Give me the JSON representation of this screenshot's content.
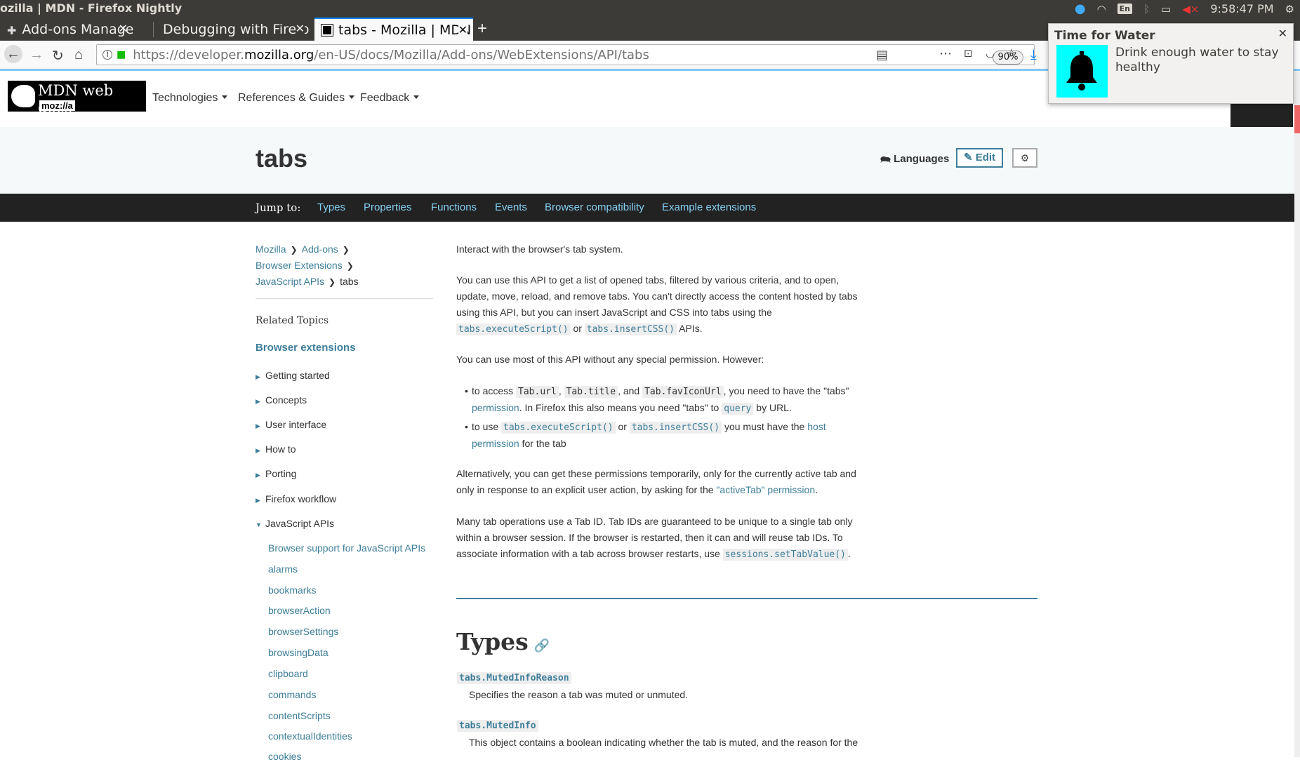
{
  "os": {
    "window_title": "ozilla | MDN - Firefox Nightly",
    "keyboard": "En",
    "clock": "9:58:47 PM"
  },
  "tabs": [
    {
      "label": "Add-ons Manager"
    },
    {
      "label": "Debugging with Firefo"
    },
    {
      "label": "tabs - Mozilla | MDN"
    }
  ],
  "navbar": {
    "url_prefix": "https://developer.",
    "url_domain": "mozilla.org",
    "url_path": "/en-US/docs/Mozilla/Add-ons/WebExtensions/API/tabs",
    "zoom": "90%"
  },
  "notification": {
    "title": "Time for Water",
    "body": "Drink enough water to stay healthy"
  },
  "mdn": {
    "logo_main": "MDN web docs",
    "logo_sub": "moz://a",
    "nav": [
      "Technologies",
      "References & Guides",
      "Feedback"
    ]
  },
  "page": {
    "title": "tabs",
    "languages": "Languages",
    "edit": "Edit"
  },
  "jump": {
    "label": "Jump to:",
    "links": [
      "Types",
      "Properties",
      "Functions",
      "Events",
      "Browser compatibility",
      "Example extensions"
    ]
  },
  "sidebar": {
    "breadcrumbs": [
      "Mozilla",
      "Add-ons",
      "Browser Extensions",
      "JavaScript APIs",
      "tabs"
    ],
    "related": "Related Topics",
    "section": "Browser extensions",
    "items": [
      "Getting started",
      "Concepts",
      "User interface",
      "How to",
      "Porting",
      "Firefox workflow",
      "JavaScript APIs"
    ],
    "subitems": [
      "Browser support for JavaScript APIs",
      "alarms",
      "bookmarks",
      "browserAction",
      "browserSettings",
      "browsingData",
      "clipboard",
      "commands",
      "contentScripts",
      "contextualIdentities",
      "cookies"
    ]
  },
  "content": {
    "p1": "Interact with the browser's tab system.",
    "p2_a": "You can use this API to get a list of opened tabs, filtered by various criteria, and to open, update, move, reload, and remove tabs. You can't directly access the content hosted by tabs using this API, but you can insert JavaScript and CSS into tabs using the",
    "code_exec": "tabs.executeScript()",
    "or": "or",
    "code_css": "tabs.insertCSS()",
    "apis": "APIs.",
    "p3": "You can use most of this API without any special permission. However:",
    "b1_a": "to access",
    "b1_url": "Tab.url",
    "b1_title": "Tab.title",
    "b1_and": ", and",
    "b1_fav": "Tab.favIconUrl",
    "b1_b": ", you need to have the \"tabs\"",
    "b1_perm": "permission",
    "b1_c": ". In Firefox this also means you need \"tabs\" to",
    "b1_query": "query",
    "b1_d": "by URL.",
    "b2_a": "to use",
    "b2_b": "you must have the",
    "b2_host": "host permission",
    "b2_c": "for the tab",
    "p4_a": "Alternatively, you can get these permissions temporarily, only for the currently active tab and only in response to an explicit user action, by asking for the",
    "p4_link": "\"activeTab\" permission",
    "p5_a": "Many tab operations use a Tab ID. Tab IDs are guaranteed to be unique to a single tab only within a browser session. If the browser is restarted, then it can and will reuse tab IDs. To associate information with a tab across browser restarts, use",
    "p5_code": "sessions.setTabValue()",
    "types_heading": "Types",
    "type1": "tabs.MutedInfoReason",
    "type1_desc": "Specifies the reason a tab was muted or unmuted.",
    "type2": "tabs.MutedInfo",
    "type2_desc": "This object contains a boolean indicating whether the tab is muted, and the reason for the"
  }
}
